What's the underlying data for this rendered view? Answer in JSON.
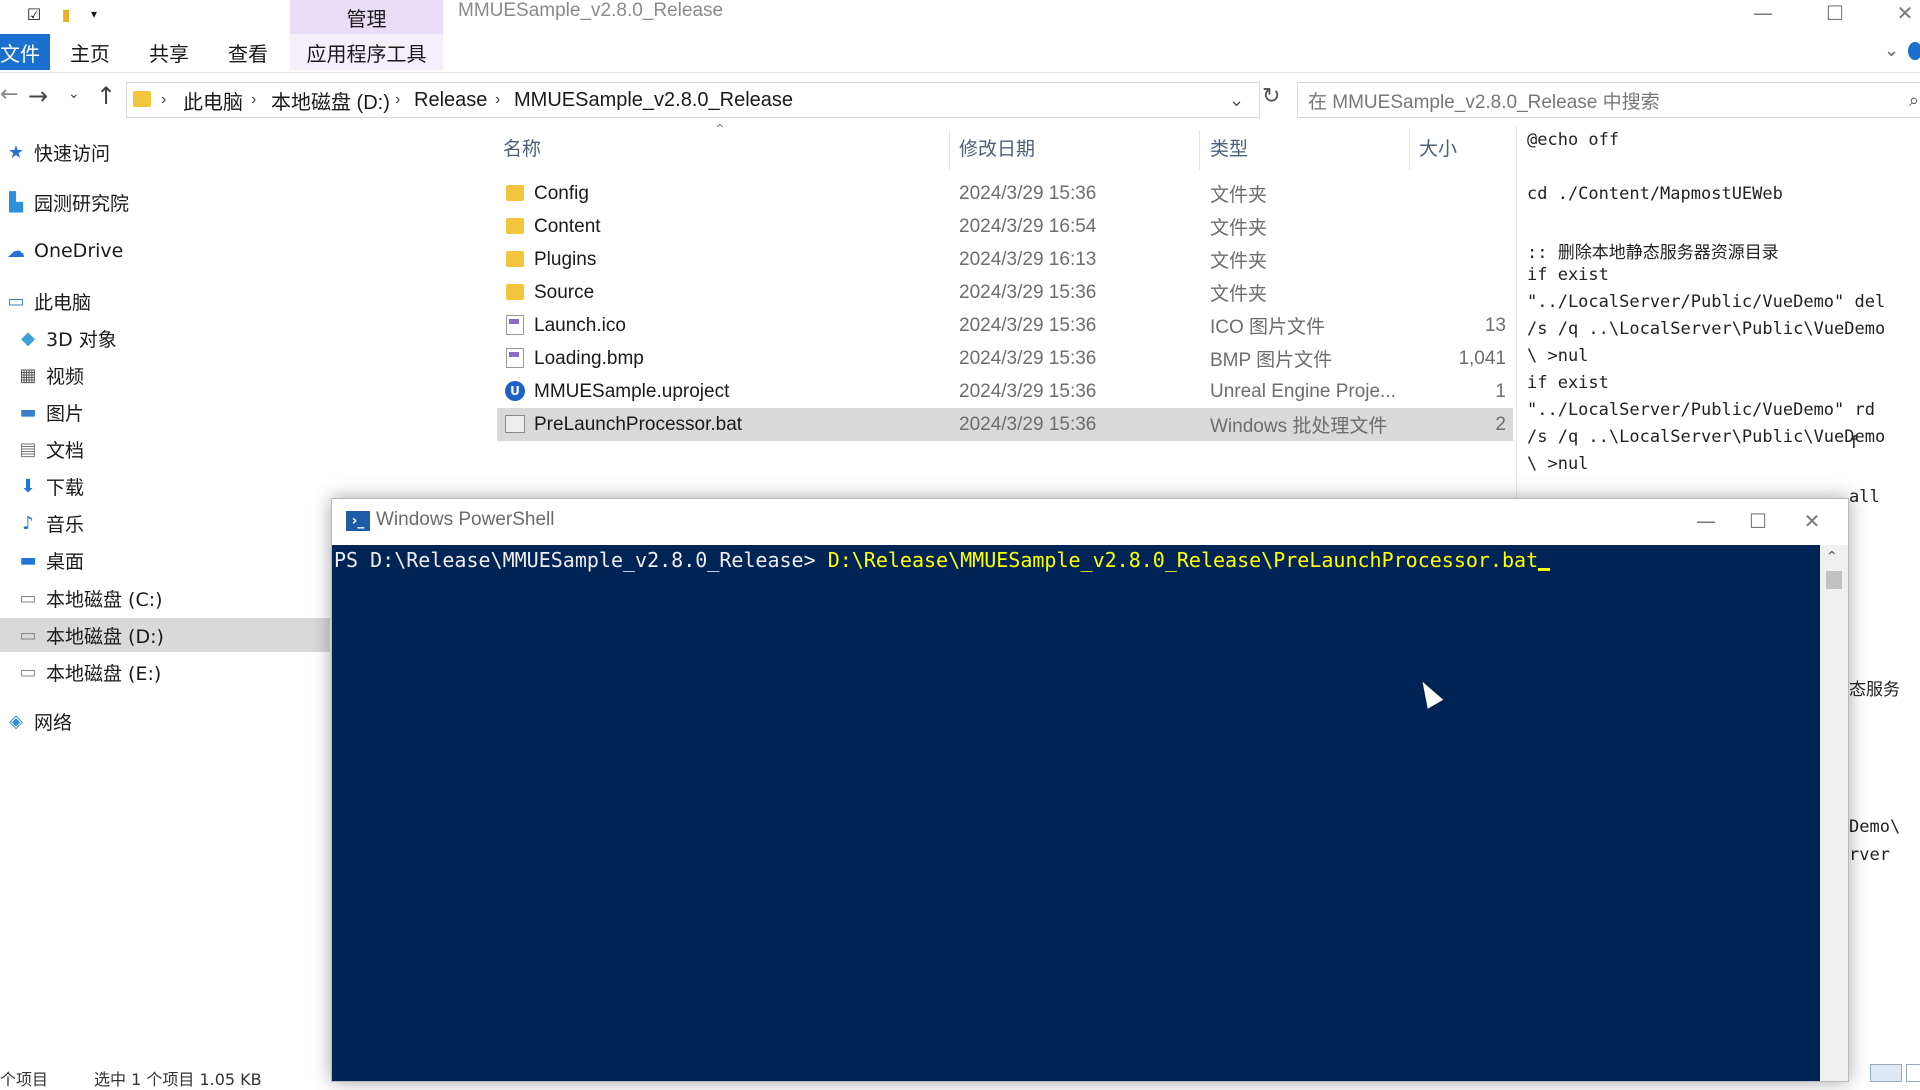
{
  "title_bar": {
    "manage_tab": "管理",
    "window_title": "MMUESample_v2.8.0_Release",
    "minimize": "—",
    "maximize": "☐",
    "close": "✕"
  },
  "ribbon": {
    "tabs": [
      "文件",
      "主页",
      "共享",
      "查看"
    ],
    "app_tools": "应用程序工具"
  },
  "address_bar": {
    "crumbs": [
      "此电脑",
      "本地磁盘 (D:)",
      "Release",
      "MMUESample_v2.8.0_Release"
    ],
    "search_placeholder": "在 MMUESample_v2.8.0_Release 中搜索"
  },
  "sidebar": {
    "items": [
      {
        "label": "快速访问",
        "icon": "star-icon"
      },
      {
        "label": "园测研究院",
        "icon": "building-icon"
      },
      {
        "label": "OneDrive",
        "icon": "cloud-icon"
      },
      {
        "label": "此电脑",
        "icon": "computer-icon"
      },
      {
        "label": "3D 对象",
        "icon": "cube-icon"
      },
      {
        "label": "视频",
        "icon": "video-icon"
      },
      {
        "label": "图片",
        "icon": "picture-icon"
      },
      {
        "label": "文档",
        "icon": "document-icon"
      },
      {
        "label": "下载",
        "icon": "download-icon"
      },
      {
        "label": "音乐",
        "icon": "music-icon"
      },
      {
        "label": "桌面",
        "icon": "desktop-icon"
      },
      {
        "label": "本地磁盘 (C:)",
        "icon": "drive-icon"
      },
      {
        "label": "本地磁盘 (D:)",
        "icon": "drive-icon",
        "selected": true
      },
      {
        "label": "本地磁盘 (E:)",
        "icon": "drive-icon"
      },
      {
        "label": "网络",
        "icon": "network-icon"
      }
    ]
  },
  "file_list": {
    "headers": {
      "name": "名称",
      "date": "修改日期",
      "type": "类型",
      "size": "大小"
    },
    "rows": [
      {
        "name": "Config",
        "date": "2024/3/29 15:36",
        "type": "文件夹",
        "size": "",
        "icon": "folder-icon"
      },
      {
        "name": "Content",
        "date": "2024/3/29 16:54",
        "type": "文件夹",
        "size": "",
        "icon": "folder-icon"
      },
      {
        "name": "Plugins",
        "date": "2024/3/29 16:13",
        "type": "文件夹",
        "size": "",
        "icon": "folder-icon"
      },
      {
        "name": "Source",
        "date": "2024/3/29 15:36",
        "type": "文件夹",
        "size": "",
        "icon": "folder-icon"
      },
      {
        "name": "Launch.ico",
        "date": "2024/3/29 15:36",
        "type": "ICO 图片文件",
        "size": "13",
        "icon": "image-file-icon"
      },
      {
        "name": "Loading.bmp",
        "date": "2024/3/29 15:36",
        "type": "BMP 图片文件",
        "size": "1,041",
        "icon": "image-file-icon"
      },
      {
        "name": "MMUESample.uproject",
        "date": "2024/3/29 15:36",
        "type": "Unreal Engine Proje...",
        "size": "1",
        "icon": "unreal-icon"
      },
      {
        "name": "PreLaunchProcessor.bat",
        "date": "2024/3/29 15:36",
        "type": "Windows 批处理文件",
        "size": "2",
        "icon": "batch-file-icon",
        "selected": true
      }
    ]
  },
  "preview": {
    "lines": [
      "@echo off",
      "",
      "cd ./Content/MapmostUEWeb",
      "",
      ":: 删除本地静态服务器资源目录",
      "if exist",
      "\"../LocalServer/Public/VueDemo\" del",
      "/s /q ..\\LocalServer\\Public\\VueDemo",
      "\\ >nul",
      "if exist",
      "\"../LocalServer/Public/VueDemo\" rd",
      "/s /q ..\\LocalServer\\Public\\VueDemo",
      "\\ >nul"
    ],
    "partial_lines": [
      "f",
      "all",
      "态服务",
      "Demo\\",
      "rver"
    ]
  },
  "status_bar": {
    "item_count": "个项目",
    "selection": "选中 1 个项目  1.05 KB"
  },
  "powershell": {
    "title": "Windows PowerShell",
    "prompt": "PS D:\\Release\\MMUESample_v2.8.0_Release> ",
    "command": "D:\\Release\\MMUESample_v2.8.0_Release\\PreLaunchProcessor.bat",
    "colors": {
      "background": "#012456",
      "command": "#ffff00",
      "prompt": "#eeedf0"
    }
  }
}
